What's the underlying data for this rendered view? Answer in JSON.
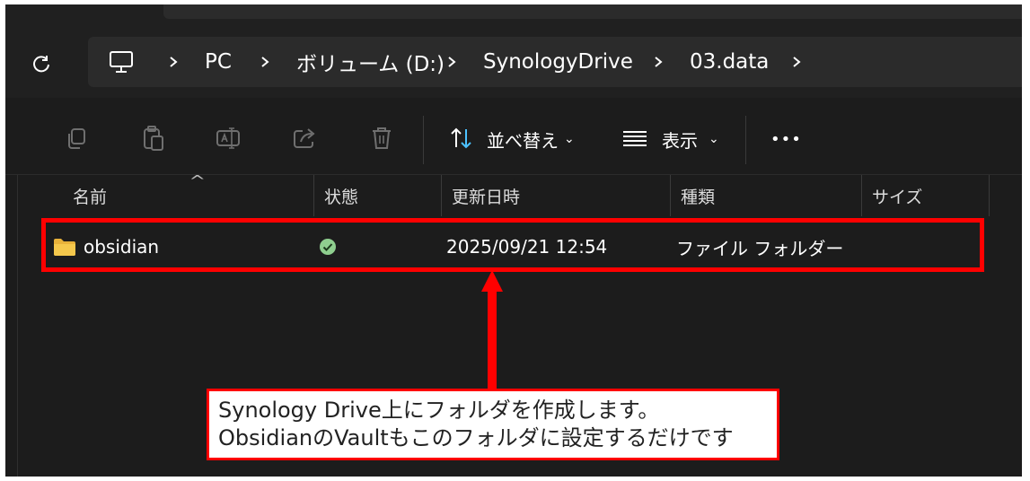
{
  "address": {
    "crumbs": [
      "PC",
      "ボリューム (D:)",
      "SynologyDrive",
      "03.data"
    ]
  },
  "toolbar": {
    "sort_label": "並べ替え",
    "view_label": "表示",
    "more_label": "•••"
  },
  "columns": {
    "name": "名前",
    "status": "状態",
    "modified": "更新日時",
    "type": "種類",
    "size": "サイズ"
  },
  "rows": [
    {
      "name": "obsidian",
      "modified": "2025/09/21 12:54",
      "type": "ファイル フォルダー",
      "status_icon": "synced-check-icon"
    }
  ],
  "annotation": {
    "line1": "Synology Drive上にフォルダを作成します。",
    "line2": "ObsidianのVaultもこのフォルダに設定するだけです"
  },
  "colors": {
    "highlight": "#ff0000",
    "folder": "#f2c14e",
    "sync_ok": "#7fbf7f"
  }
}
